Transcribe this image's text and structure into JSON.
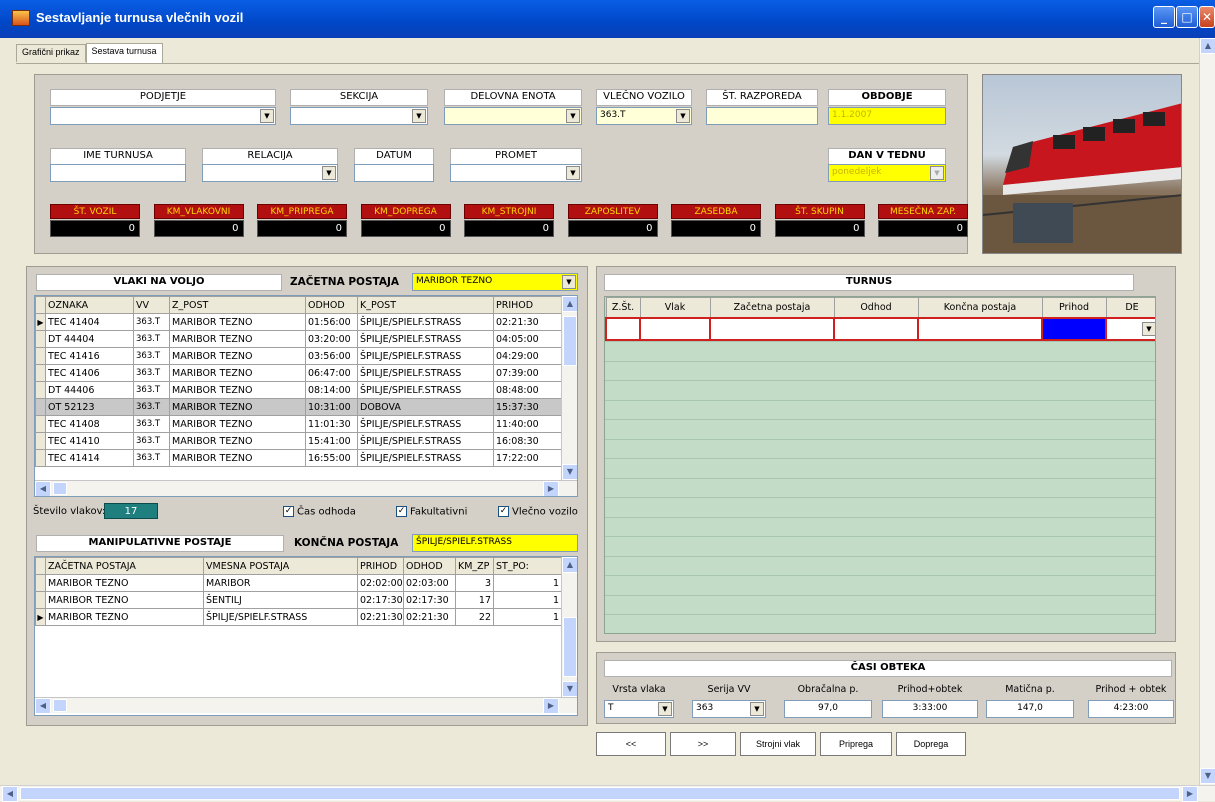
{
  "window": {
    "title": "Sestavljanje turnusa vlečnih vozil"
  },
  "tabs": [
    "Grafični prikaz",
    "Sestava turnusa"
  ],
  "filters": {
    "podjetje": {
      "label": "PODJETJE",
      "value": ""
    },
    "sekcija": {
      "label": "SEKCIJA",
      "value": ""
    },
    "delovna_enota": {
      "label": "DELOVNA ENOTA",
      "value": ""
    },
    "vlecno_vozilo": {
      "label": "VLEČNO VOZILO",
      "value": "363.T"
    },
    "st_razporeda": {
      "label": "ŠT. RAZPOREDA",
      "value": ""
    },
    "obdobje": {
      "label": "OBDOBJE",
      "value": "1.1.2007"
    },
    "ime_turnusa": {
      "label": "IME TURNUSA",
      "value": ""
    },
    "relacija": {
      "label": "RELACIJA",
      "value": ""
    },
    "datum": {
      "label": "DATUM",
      "value": ""
    },
    "promet": {
      "label": "PROMET",
      "value": ""
    },
    "dan_v_tednu": {
      "label": "DAN V TEDNU",
      "value": "ponedeljek"
    }
  },
  "stats": [
    {
      "label": "ŠT. VOZIL",
      "value": "0"
    },
    {
      "label": "KM_VLAKOVNI",
      "value": "0"
    },
    {
      "label": "KM_PRIPREGA",
      "value": "0"
    },
    {
      "label": "KM_DOPREGA",
      "value": "0"
    },
    {
      "label": "KM_STROJNI",
      "value": "0"
    },
    {
      "label": "ZAPOSLITEV",
      "value": "0"
    },
    {
      "label": "ZASEDBA",
      "value": "0"
    },
    {
      "label": "ŠT. SKUPIN",
      "value": "0"
    },
    {
      "label": "MESEČNA ZAP.",
      "value": "0"
    }
  ],
  "trains": {
    "title": "VLAKI NA VOLJO",
    "start_label": "ZAČETNA POSTAJA",
    "start_value": "MARIBOR TEZNO",
    "headers": [
      "OZNAKA",
      "VV",
      "Z_POST",
      "ODHOD",
      "K_POST",
      "PRIHOD"
    ],
    "rows": [
      [
        "TEC   41404",
        "363.T",
        "MARIBOR TEZNO",
        "01:56:00",
        "ŠPILJE/SPIELF.STRASS",
        "02:21:30"
      ],
      [
        "DT    44404",
        "363.T",
        "MARIBOR TEZNO",
        "03:20:00",
        "ŠPILJE/SPIELF.STRASS",
        "04:05:00"
      ],
      [
        "TEC   41416",
        "363.T",
        "MARIBOR TEZNO",
        "03:56:00",
        "ŠPILJE/SPIELF.STRASS",
        "04:29:00"
      ],
      [
        "TEC   41406",
        "363.T",
        "MARIBOR TEZNO",
        "06:47:00",
        "ŠPILJE/SPIELF.STRASS",
        "07:39:00"
      ],
      [
        "DT    44406",
        "363.T",
        "MARIBOR TEZNO",
        "08:14:00",
        "ŠPILJE/SPIELF.STRASS",
        "08:48:00"
      ],
      [
        "OT    52123",
        "363.T",
        "MARIBOR TEZNO",
        "10:31:00",
        "DOBOVA",
        "15:37:30"
      ],
      [
        "TEC   41408",
        "363.T",
        "MARIBOR TEZNO",
        "11:01:30",
        "ŠPILJE/SPIELF.STRASS",
        "11:40:00"
      ],
      [
        "TEC   41410",
        "363.T",
        "MARIBOR TEZNO",
        "15:41:00",
        "ŠPILJE/SPIELF.STRASS",
        "16:08:30"
      ],
      [
        "TEC   41414",
        "363.T",
        "MARIBOR TEZNO",
        "16:55:00",
        "ŠPILJE/SPIELF.STRASS",
        "17:22:00"
      ]
    ],
    "count_label": "Število vlakov:",
    "count": "17"
  },
  "checks": [
    {
      "label": "Čas odhoda",
      "checked": true
    },
    {
      "label": "Fakultativni",
      "checked": true
    },
    {
      "label": "Vlečno vozilo",
      "checked": true
    }
  ],
  "manip": {
    "title": "MANIPULATIVNE POSTAJE",
    "end_label": "KONČNA POSTAJA",
    "end_value": "ŠPILJE/SPIELF.STRASS",
    "headers": [
      "ZAČETNA POSTAJA",
      "VMESNA POSTAJA",
      "PRIHOD",
      "ODHOD",
      "KM_ZP",
      "ST_PO:"
    ],
    "rows": [
      [
        "MARIBOR TEZNO",
        "MARIBOR",
        "02:02:00",
        "02:03:00",
        "3",
        "1"
      ],
      [
        "MARIBOR TEZNO",
        "ŠENTILJ",
        "02:17:30",
        "02:17:30",
        "17",
        "1"
      ],
      [
        "MARIBOR TEZNO",
        "ŠPILJE/SPIELF.STRASS",
        "02:21:30",
        "02:21:30",
        "22",
        "1"
      ]
    ]
  },
  "turnus": {
    "title": "TURNUS",
    "headers": [
      "Z.Št.",
      "Vlak",
      "Začetna postaja",
      "Odhod",
      "Končna postaja",
      "Prihod",
      "DE"
    ]
  },
  "casi": {
    "title": "ČASI OBTEKA",
    "fields": [
      {
        "label": "Vrsta vlaka",
        "value": "T"
      },
      {
        "label": "Serija VV",
        "value": "363"
      },
      {
        "label": "Obračalna p.",
        "value": "97,0"
      },
      {
        "label": "Prihod+obtek",
        "value": "3:33:00"
      },
      {
        "label": "Matična p.",
        "value": "147,0"
      },
      {
        "label": "Prihod + obtek",
        "value": "4:23:00"
      }
    ]
  },
  "buttons": [
    "<<",
    ">>",
    "Strojni vlak",
    "Priprega",
    "Doprega"
  ],
  "colors": {
    "green": "#c3dcc8",
    "yellow": "#ffff00",
    "red_label": "#b21010"
  }
}
